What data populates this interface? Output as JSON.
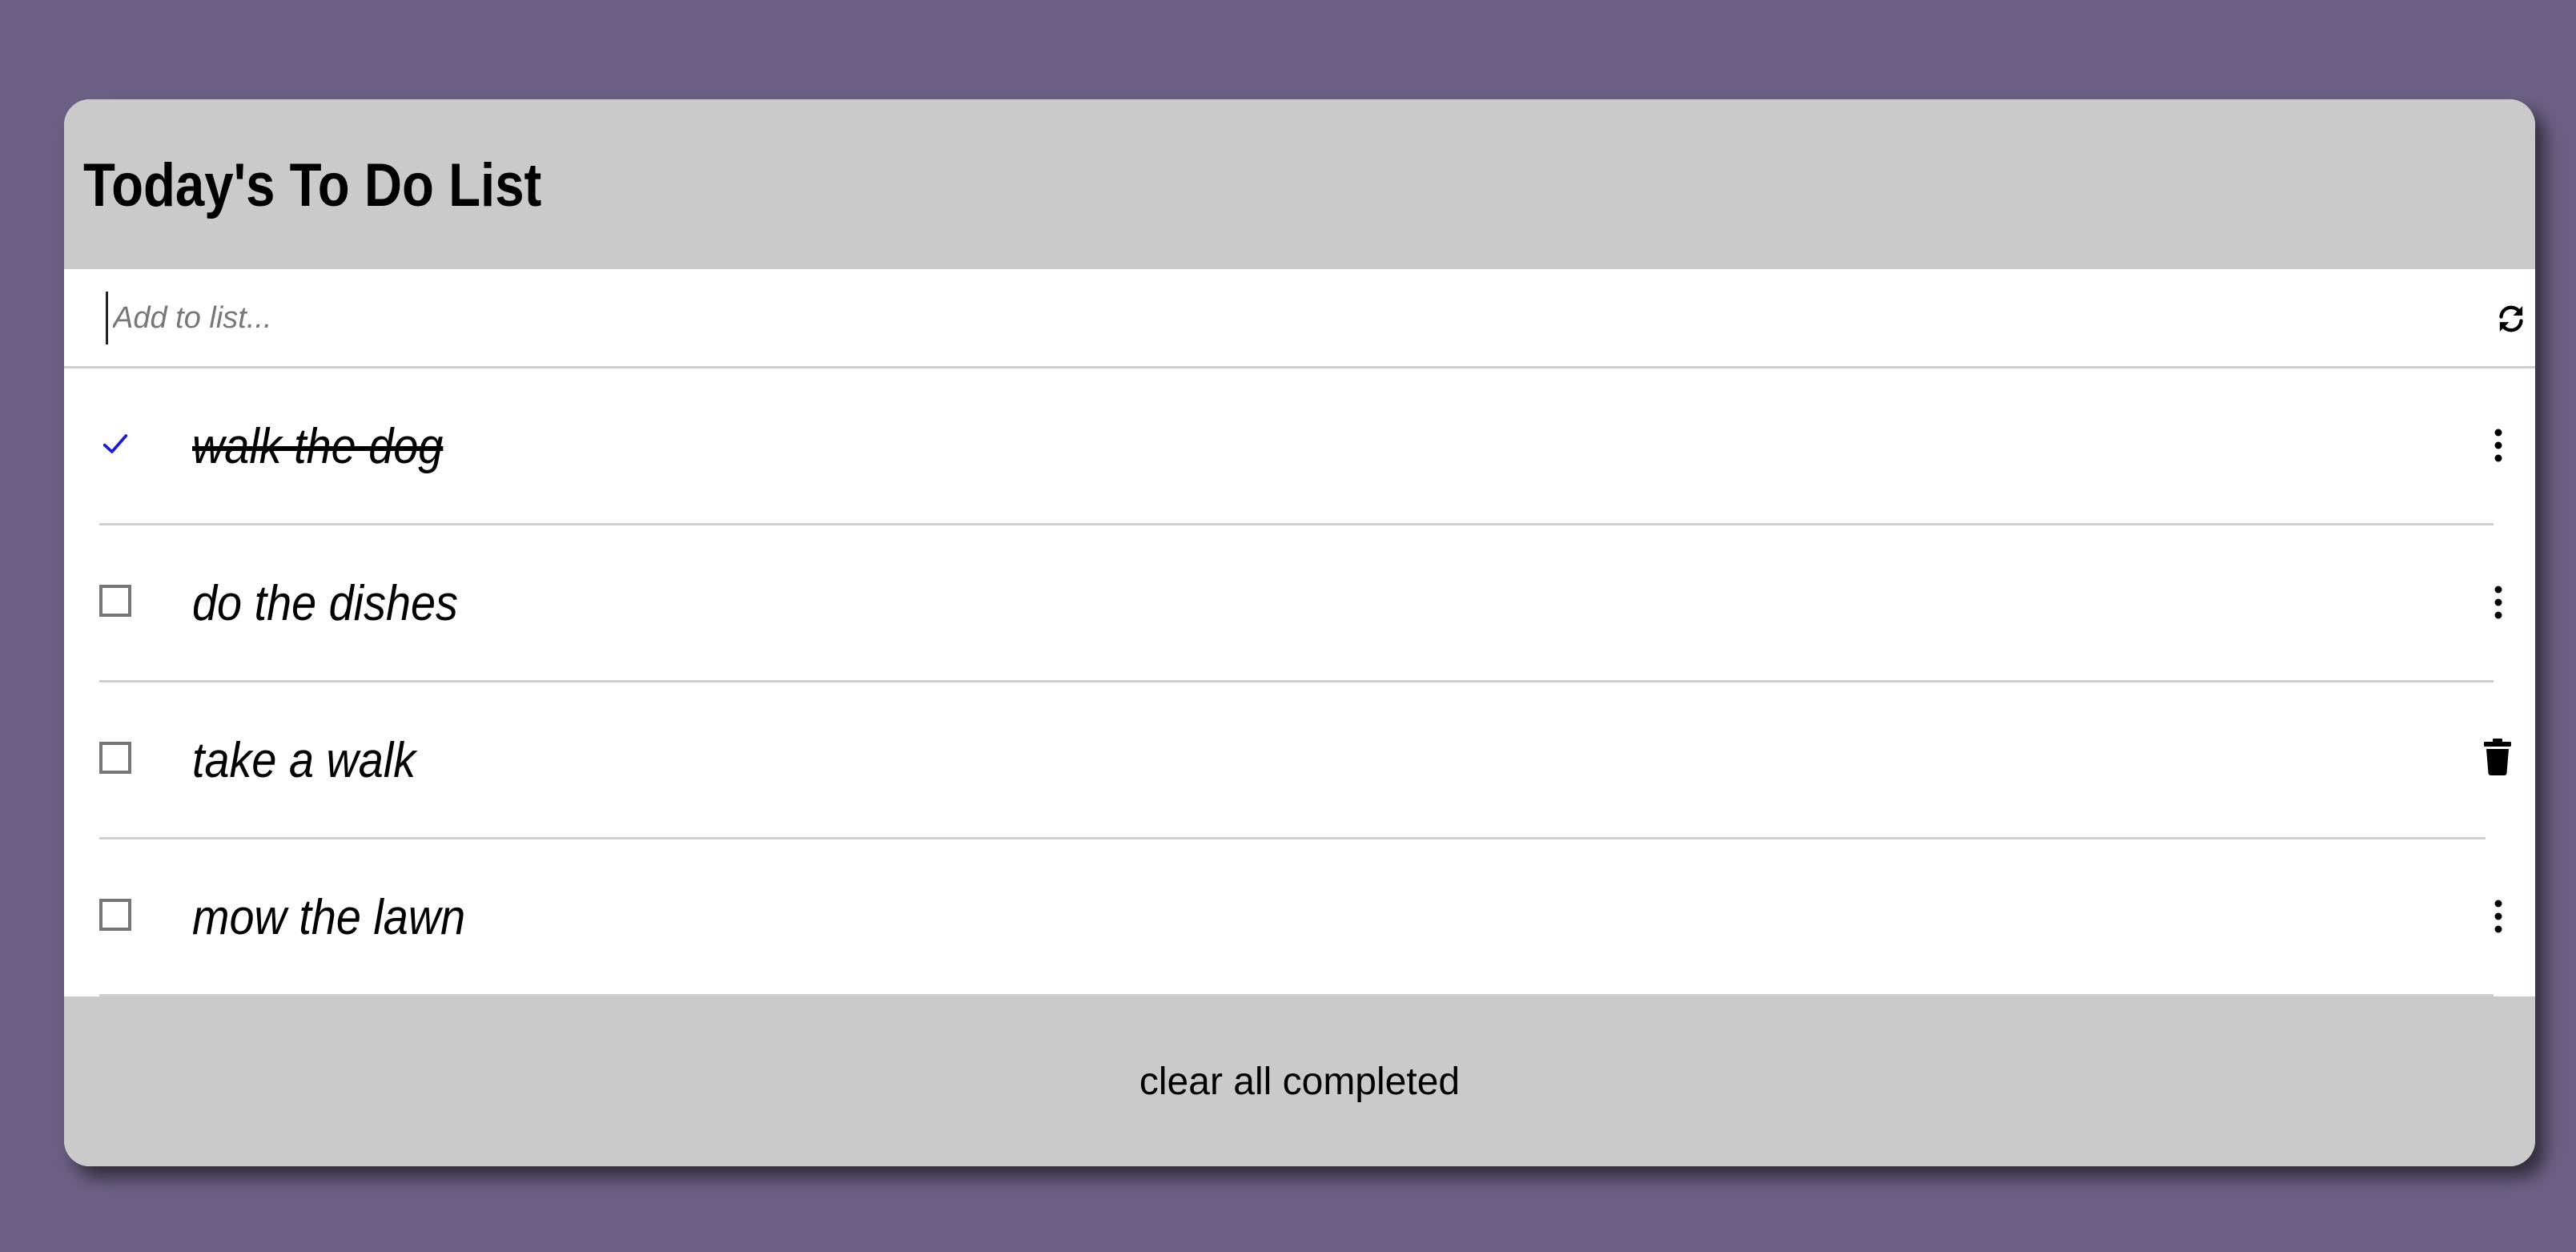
{
  "app": {
    "title": "Today's To Do List"
  },
  "add_input": {
    "placeholder": "Add to list...",
    "value": ""
  },
  "icons": {
    "refresh": "refresh-icon",
    "checkmark": "checkmark-icon",
    "more": "more-vertical-icon",
    "trash": "trash-icon"
  },
  "colors": {
    "background": "#6b6185",
    "panel": "#cacaca",
    "checkmark": "#1a1adb"
  },
  "items": [
    {
      "label": "walk the dog",
      "completed": true,
      "action_icon": "more-vertical-icon"
    },
    {
      "label": "do the dishes",
      "completed": false,
      "action_icon": "more-vertical-icon"
    },
    {
      "label": "take a walk",
      "completed": false,
      "action_icon": "trash-icon"
    },
    {
      "label": "mow the lawn",
      "completed": false,
      "action_icon": "more-vertical-icon"
    }
  ],
  "footer": {
    "clear_label": "clear all completed"
  }
}
